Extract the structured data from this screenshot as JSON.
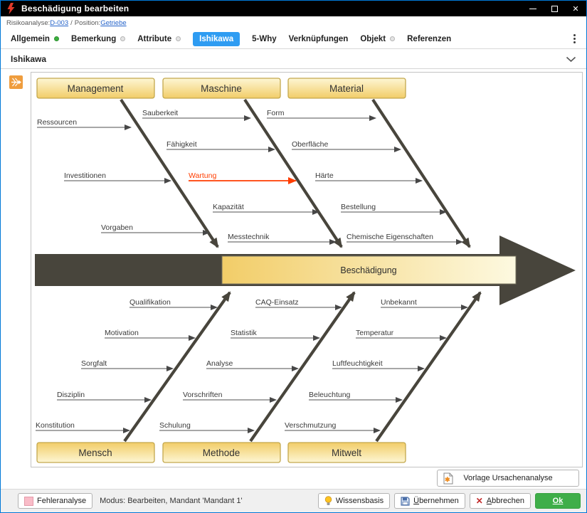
{
  "window": {
    "title": "Beschädigung bearbeiten"
  },
  "breadcrumb": {
    "label_risikoanalyse": "Risikoanalyse:",
    "link_risikoanalyse": "D-003",
    "separator": "/",
    "label_position": "Position:",
    "link_position": "Getriebe"
  },
  "tabs": [
    {
      "label": "Allgemein",
      "dot": "green"
    },
    {
      "label": "Bemerkung",
      "dot": "gray"
    },
    {
      "label": "Attribute",
      "dot": "gray"
    },
    {
      "label": "Ishikawa",
      "active": true
    },
    {
      "label": "5-Why"
    },
    {
      "label": "Verknüpfungen"
    },
    {
      "label": "Objekt",
      "dot": "gray"
    },
    {
      "label": "Referenzen"
    }
  ],
  "section": {
    "title": "Ishikawa"
  },
  "diagram": {
    "effect": "Beschädigung",
    "top_boxes": [
      "Management",
      "Maschine",
      "Material"
    ],
    "bottom_boxes": [
      "Mensch",
      "Methode",
      "Mitwelt"
    ],
    "causes": {
      "management": [
        "Ressourcen",
        "Investitionen",
        "Vorgaben"
      ],
      "maschine": [
        "Sauberkeit",
        "Fähigkeit",
        "Wartung",
        "Kapazität",
        "Messtechnik"
      ],
      "material": [
        "Form",
        "Oberfläche",
        "Härte",
        "Bestellung",
        "Chemische Eigenschaften"
      ],
      "mensch": [
        "Qualifikation",
        "Motivation",
        "Sorgfalt",
        "Disziplin",
        "Konstitution"
      ],
      "methode": [
        "CAQ-Einsatz",
        "Statistik",
        "Analyse",
        "Vorschriften",
        "Schulung"
      ],
      "mitwelt": [
        "Unbekannt",
        "Temperatur",
        "Luftfeuchtigkeit",
        "Beleuchtung",
        "Verschmutzung"
      ]
    },
    "highlighted_cause": "Wartung",
    "colors": {
      "highlight_orange": "#ff3d00",
      "bone_dark": "#48453c",
      "box_border": "#c3a84e",
      "active_tab_blue": "#2e9cf2",
      "link_blue": "#2563c9",
      "ok_green": "#3fae49",
      "status_green_dot": "#3db03f"
    }
  },
  "footer": {
    "vorlage_button": "Vorlage Ursachenanalyse"
  },
  "statusbar": {
    "fehleranalyse_button": "Fehleranalyse",
    "status_text": "Modus: Bearbeiten, Mandant 'Mandant 1'",
    "wissensbasis_button": "Wissensbasis",
    "uebernehmen_mnemonic": "Ü",
    "uebernehmen_rest": "bernehmen",
    "abbrechen_mnemonic": "A",
    "abbrechen_rest": "bbrechen",
    "ok_button": "Ok"
  }
}
